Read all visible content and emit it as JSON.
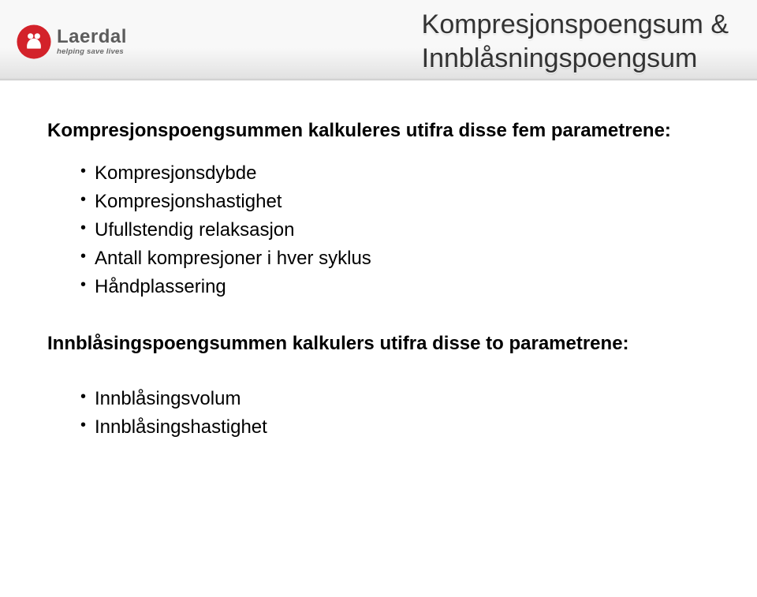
{
  "header": {
    "logo_word": "Laerdal",
    "logo_tagline": "helping save lives",
    "title_line1": "Kompresjonspoengsum &",
    "title_line2": "Innblåsningspoengsum"
  },
  "content": {
    "heading1": "Kompresjonspoengsummen kalkuleres utifra disse fem parametrene:",
    "list1": [
      "Kompresjonsdybde",
      "Kompresjonshastighet",
      "Ufullstendig relaksasjon",
      "Antall kompresjoner i hver syklus",
      "Håndplassering"
    ],
    "heading2": "Innblåsingspoengsummen kalkulers utifra disse to parametrene:",
    "list2": [
      "Innblåsingsvolum",
      "Innblåsingshastighet"
    ]
  }
}
